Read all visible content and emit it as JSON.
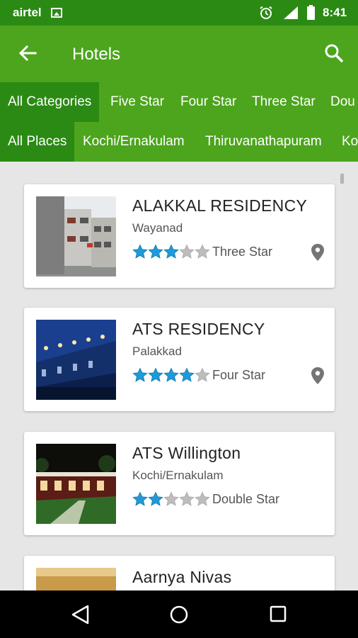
{
  "status_bar": {
    "carrier": "airtel",
    "time": "8:41"
  },
  "app_bar": {
    "title": "Hotels"
  },
  "category_tabs": [
    "All Categories",
    "Five Star",
    "Four Star",
    "Three Star",
    "Dou"
  ],
  "place_tabs": [
    "All Places",
    "Kochi/Ernakulam",
    "Thiruvanathapuram",
    "Ko"
  ],
  "hotels": [
    {
      "name": "ALAKKAL RESIDENCY",
      "place": "Wayanad",
      "rating": 3,
      "category": "Three Star",
      "has_location": true
    },
    {
      "name": "ATS RESIDENCY",
      "place": "Palakkad",
      "rating": 4,
      "category": "Four Star",
      "has_location": true
    },
    {
      "name": "ATS Willington",
      "place": "Kochi/Ernakulam",
      "rating": 2,
      "category": "Double Star",
      "has_location": false
    },
    {
      "name": "Aarnya Nivas",
      "place": "",
      "rating": 0,
      "category": "",
      "has_location": false
    }
  ],
  "colors": {
    "app_bar": "#4ca51c",
    "status_bar": "#2b8a14",
    "active_tab": "#2b8a14",
    "star_filled": "#1e9bd7",
    "star_empty": "#bdbdbd"
  }
}
